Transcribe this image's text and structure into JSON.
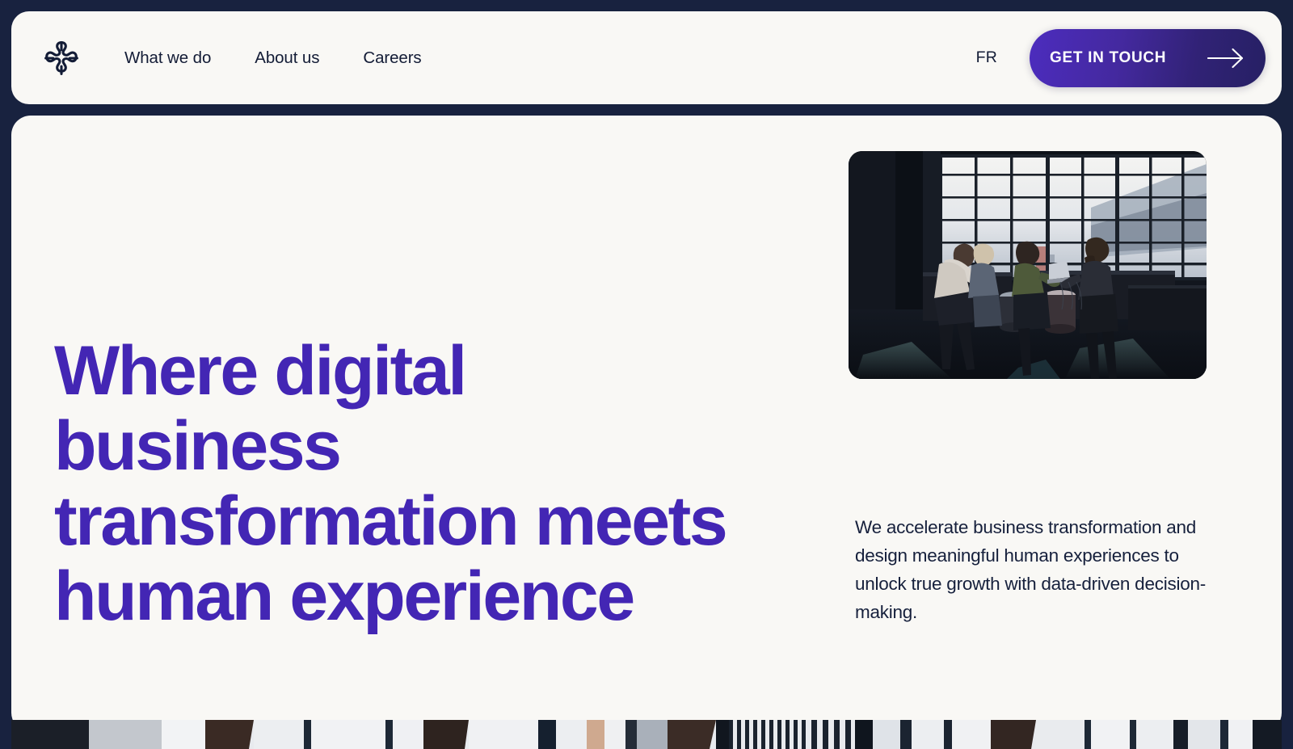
{
  "theme": {
    "page_bg": "#18223f",
    "card_bg": "#f9f8f5",
    "ink": "#131c36",
    "heading_purple": "#4326b4",
    "cta_gradient_start": "#4c2cbe",
    "cta_gradient_end": "#262064",
    "cta_text": "#ffffff"
  },
  "header": {
    "logo_name": "asterisk-logo",
    "nav": [
      {
        "label": "What we do"
      },
      {
        "label": "About us"
      },
      {
        "label": "Careers"
      }
    ],
    "language": "FR",
    "cta": {
      "label": "GET IN TOUCH",
      "icon": "arrow-right-icon"
    }
  },
  "hero": {
    "title_lines": [
      "Where digital",
      "business",
      "transformation meets",
      "human experience"
    ],
    "title": "Where digital business transformation meets human experience",
    "description": "We accelerate business transformation and design meaningful human experiences to unlock true growth with data-driven decision-making.",
    "photo_alt": "office-meeting-photo",
    "peek_photo_alt": "secondary-office-photo"
  }
}
